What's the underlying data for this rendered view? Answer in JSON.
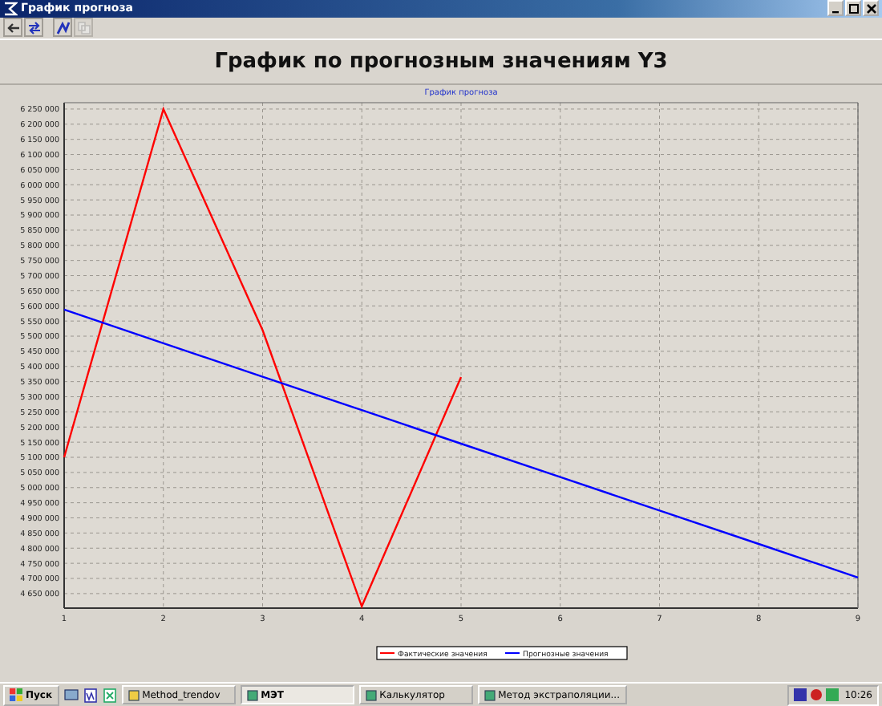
{
  "window": {
    "title": "График прогноза"
  },
  "toolbar": {
    "buttons": [
      {
        "kind": "back",
        "disabled": false
      },
      {
        "kind": "swap",
        "disabled": false
      },
      {
        "kind": "chart",
        "disabled": false
      },
      {
        "kind": "copy",
        "disabled": true
      }
    ]
  },
  "heading": "График по прогнозным значениям Y3",
  "chart": {
    "chart_data": {
      "type": "line",
      "title": "График прогноза",
      "grid": true,
      "legend": true,
      "x": [
        1,
        2,
        3,
        4,
        5,
        6,
        7,
        8,
        9
      ],
      "xticks": [
        1,
        2,
        3,
        4,
        5,
        6,
        7,
        8,
        9
      ],
      "xlim": [
        1,
        9
      ],
      "ylim": [
        4602000,
        6271000
      ],
      "yticks": [
        {
          "value": 4650000,
          "label": "4 650 000"
        },
        {
          "value": 4700000,
          "label": "4 700 000"
        },
        {
          "value": 4750000,
          "label": "4 750 000"
        },
        {
          "value": 4800000,
          "label": "4 800 000"
        },
        {
          "value": 4850000,
          "label": "4 850 000"
        },
        {
          "value": 4900000,
          "label": "4 900 000"
        },
        {
          "value": 4950000,
          "label": "4 950 000"
        },
        {
          "value": 5000000,
          "label": "5 000 000"
        },
        {
          "value": 5050000,
          "label": "5 050 000"
        },
        {
          "value": 5100000,
          "label": "5 100 000"
        },
        {
          "value": 5150000,
          "label": "5 150 000"
        },
        {
          "value": 5200000,
          "label": "5 200 000"
        },
        {
          "value": 5250000,
          "label": "5 250 000"
        },
        {
          "value": 5300000,
          "label": "5 300 000"
        },
        {
          "value": 5350000,
          "label": "5 350 000"
        },
        {
          "value": 5400000,
          "label": "5 400 000"
        },
        {
          "value": 5450000,
          "label": "5 450 000"
        },
        {
          "value": 5500000,
          "label": "5 500 000"
        },
        {
          "value": 5550000,
          "label": "5 550 000"
        },
        {
          "value": 5600000,
          "label": "5 600 000"
        },
        {
          "value": 5650000,
          "label": "5 650 000"
        },
        {
          "value": 5700000,
          "label": "5 700 000"
        },
        {
          "value": 5750000,
          "label": "5 750 000"
        },
        {
          "value": 5800000,
          "label": "5 800 000"
        },
        {
          "value": 5850000,
          "label": "5 850 000"
        },
        {
          "value": 5900000,
          "label": "5 900 000"
        },
        {
          "value": 5950000,
          "label": "5 950 000"
        },
        {
          "value": 6000000,
          "label": "6 000 000"
        },
        {
          "value": 6050000,
          "label": "6 050 000"
        },
        {
          "value": 6100000,
          "label": "6 100 000"
        },
        {
          "value": 6150000,
          "label": "6 150 000"
        },
        {
          "value": 6200000,
          "label": "6 200 000"
        },
        {
          "value": 6250000,
          "label": "6 250 000"
        }
      ],
      "series": [
        {
          "name": "Фактические значения",
          "color": "#ff0000",
          "values": [
            5100000,
            6250000,
            5519000,
            4608000,
            5365000,
            null,
            null,
            null,
            null
          ]
        },
        {
          "name": "Прогнозные значения",
          "color": "#0000ff",
          "values": [
            5588000,
            5477000,
            5366000,
            5256000,
            5145000,
            5035000,
            4924000,
            4814000,
            4703000
          ]
        }
      ]
    }
  },
  "taskbar": {
    "start": "Пуск",
    "tasks": [
      {
        "label": "Method_trendov",
        "selected": false
      },
      {
        "label": "МЭТ",
        "selected": true
      },
      {
        "label": "Калькулятор",
        "selected": false
      },
      {
        "label": "Метод экстраполяции...",
        "selected": false
      }
    ],
    "clock": "10:26"
  }
}
